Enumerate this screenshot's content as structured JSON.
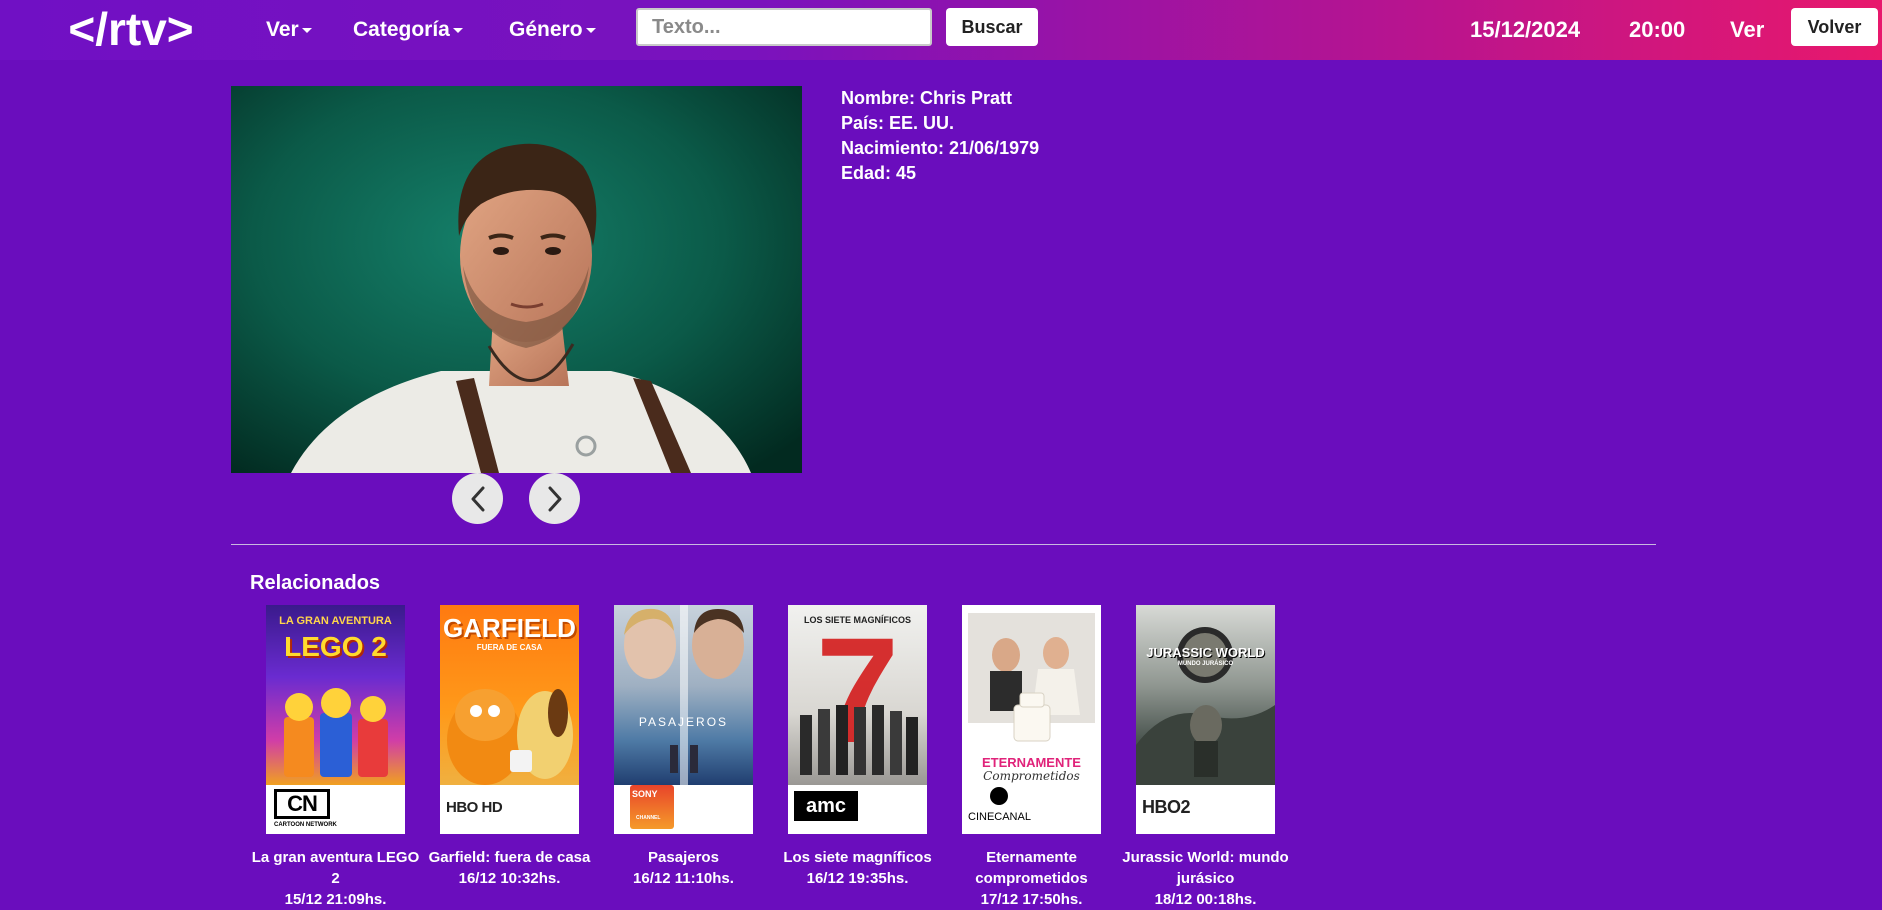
{
  "header": {
    "logo_text": "</rtv>",
    "nav": [
      {
        "label": "Ver"
      },
      {
        "label": "Categoría"
      },
      {
        "label": "Género"
      }
    ],
    "search": {
      "placeholder": "Texto...",
      "value": "",
      "button_label": "Buscar"
    },
    "date": "15/12/2024",
    "time": "20:00",
    "ver_label": "Ver",
    "volver_label": "Volver"
  },
  "profile": {
    "nombre": "Nombre: Chris Pratt",
    "pais": "País: EE. UU.",
    "nacimiento": "Nacimiento: 21/06/1979",
    "edad": "Edad: 45"
  },
  "related": {
    "title": "Relacionados",
    "items": [
      {
        "title": "La gran aventura LEGO 2",
        "time": "15/12 21:09hs.",
        "channel": "CN",
        "channel_sub": "CARTOON NETWORK",
        "poster_text": "LEGO 2",
        "poster_top": "LA GRAN AVENTURA"
      },
      {
        "title": "Garfield: fuera de casa",
        "time": "16/12 10:32hs.",
        "channel": "HBO HD",
        "poster_text": "GARFIELD",
        "poster_top": "FUERA DE CASA"
      },
      {
        "title": "Pasajeros",
        "time": "16/12 11:10hs.",
        "channel": "SONY",
        "channel_sub": "CHANNEL",
        "poster_text": "PASAJEROS"
      },
      {
        "title": "Los siete magníficos",
        "time": "16/12 19:35hs.",
        "channel": "amc",
        "poster_text": "7",
        "poster_top": "LOS SIETE MAGNÍFICOS"
      },
      {
        "title": "Eternamente comprometidos",
        "time": "17/12 17:50hs.",
        "channel": "CINECANAL",
        "poster_text": "ETERNAMENTE",
        "poster_top": "Comprometidos"
      },
      {
        "title": "Jurassic World: mundo jurásico",
        "time": "18/12 00:18hs.",
        "channel": "HBO2",
        "poster_text": "JURASSIC WORLD",
        "poster_top": "MUNDO JURÁSICO"
      }
    ]
  },
  "colors": {
    "background": "#6a0dbd",
    "header_gradient_start": "#7010c4",
    "header_gradient_end": "#e8186c"
  }
}
